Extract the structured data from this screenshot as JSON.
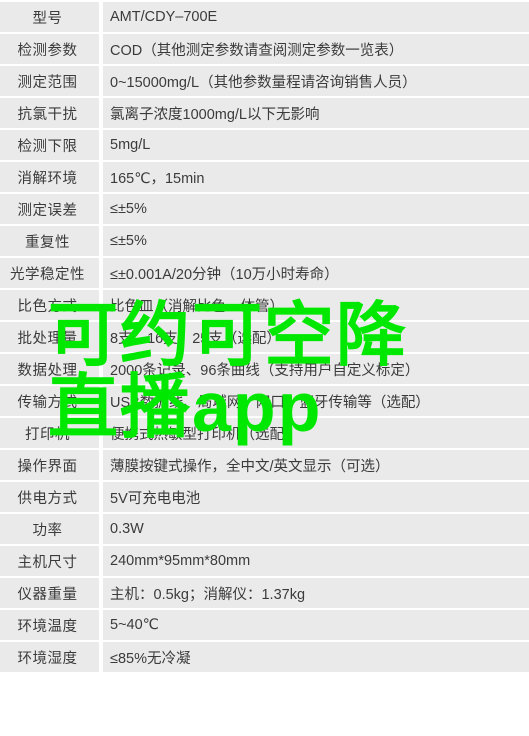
{
  "table": {
    "rows": [
      {
        "label": "型号",
        "value": "AMT/CDY–700E"
      },
      {
        "label": "检测参数",
        "value": "COD（其他测定参数请查阅测定参数一览表）"
      },
      {
        "label": "测定范围",
        "value": "0~15000mg/L（其他参数量程请咨询销售人员）"
      },
      {
        "label": "抗氯干扰",
        "value": "氯离子浓度1000mg/L以下无影响"
      },
      {
        "label": "检测下限",
        "value": "5mg/L"
      },
      {
        "label": "消解环境",
        "value": "165℃，15min"
      },
      {
        "label": "测定误差",
        "value": "≤±5%"
      },
      {
        "label": "重复性",
        "value": "≤±5%"
      },
      {
        "label": "光学稳定性",
        "value": "≤±0.001A/20分钟（10万小时寿命）"
      },
      {
        "label": "比色方式",
        "value": "比色皿（消解比色一体管）"
      },
      {
        "label": "批处理量",
        "value": "8支、16支、25支（选配）"
      },
      {
        "label": "数据处理",
        "value": "2000条记录、96条曲线（支持用户自定义标定）"
      },
      {
        "label": "传输方式",
        "value": "USB数据线、局域网、网口、蓝牙传输等（选配）"
      },
      {
        "label": "打印机",
        "value": "便携式热敏型打印机（选配）"
      },
      {
        "label": "操作界面",
        "value": "薄膜按键式操作，全中文/英文显示（可选）"
      },
      {
        "label": "供电方式",
        "value": "5V可充电电池"
      },
      {
        "label": "功率",
        "value": "0.3W"
      },
      {
        "label": "主机尺寸",
        "value": "240mm*95mm*80mm"
      },
      {
        "label": "仪器重量",
        "value": "主机：0.5kg；消解仪：1.37kg"
      },
      {
        "label": "环境温度",
        "value": "5~40℃"
      },
      {
        "label": "环境湿度",
        "value": "≤85%无冷凝"
      }
    ]
  },
  "watermark": {
    "line1": "可约可空降",
    "line2": "直播app",
    "color": "#00e800"
  },
  "colors": {
    "row_background": "#eaeaea",
    "page_background": "#ffffff",
    "text": "#3b3b3b"
  }
}
